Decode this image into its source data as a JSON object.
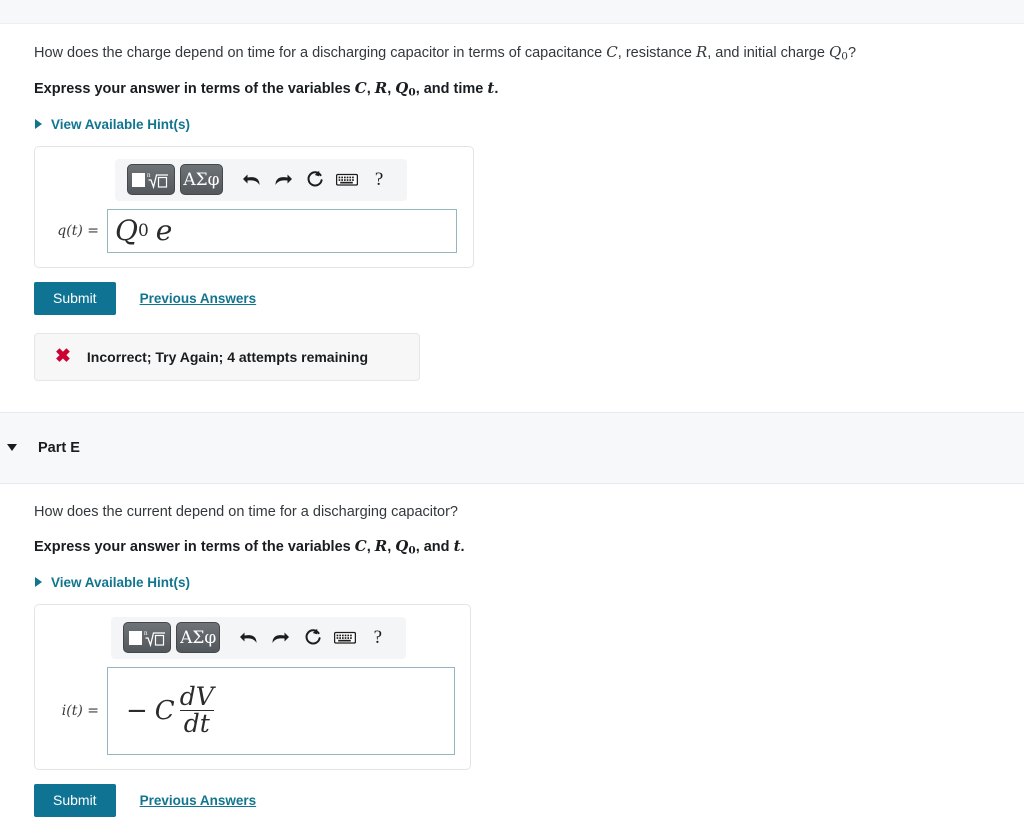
{
  "parts": [
    {
      "id": "part-d",
      "question_prefix": "How does the charge depend on time for a discharging capacitor in terms of capacitance ",
      "question_var1": "C",
      "question_mid1": ", resistance ",
      "question_var2": "R",
      "question_mid2": ", and initial charge ",
      "question_var3": "Q",
      "question_var3_sub": "0",
      "question_suffix": "?",
      "instruction_prefix": "Express your answer in terms of the variables ",
      "instruction_v1": "C",
      "instruction_sep1": ", ",
      "instruction_v2": "R",
      "instruction_sep2": ", ",
      "instruction_v3": "Q",
      "instruction_v3_sub": "0",
      "instruction_mid": ", and time ",
      "instruction_v4": "t",
      "instruction_suffix": ".",
      "hints_label": "View Available Hint(s)",
      "toolbar": {
        "template_button": "template-square-root",
        "greek_button": "ΑΣφ",
        "undo": "undo-arrow",
        "redo": "redo-arrow",
        "reset": "reset-circular-arrow",
        "keyboard": "keyboard",
        "help": "?"
      },
      "answer_label_fn": "q",
      "answer_label_arg": "(t)",
      "answer_label_eq": "=",
      "answer_value": "Q",
      "answer_value_sub": "0",
      "answer_value_tail": "e",
      "submit_label": "Submit",
      "previous_answers_label": "Previous Answers",
      "feedback": {
        "icon": "red-x",
        "text": "Incorrect; Try Again; 4 attempts remaining"
      }
    },
    {
      "id": "part-e",
      "header_title": "Part E",
      "question_text": "How does the current depend on time for a discharging capacitor?",
      "instruction_prefix": "Express your answer in terms of the variables ",
      "instruction_v1": "C",
      "instruction_sep1": ", ",
      "instruction_v2": "R",
      "instruction_sep2": ", ",
      "instruction_v3": "Q",
      "instruction_v3_sub": "0",
      "instruction_mid": ", and ",
      "instruction_v4": "t",
      "instruction_suffix": ".",
      "hints_label": "View Available Hint(s)",
      "toolbar": {
        "template_button": "template-square-root",
        "greek_button": "ΑΣφ",
        "undo": "undo-arrow",
        "redo": "redo-arrow",
        "reset": "reset-circular-arrow",
        "keyboard": "keyboard",
        "help": "?"
      },
      "answer_label_fn": "i",
      "answer_label_arg": "(t)",
      "answer_label_eq": "=",
      "answer_minus": "−",
      "answer_coeff": "C",
      "answer_frac_num": "dV",
      "answer_frac_den": "dt",
      "submit_label": "Submit",
      "previous_answers_label": "Previous Answers"
    }
  ],
  "colors": {
    "accent_link": "#11758f",
    "submit_button": "#0f7494",
    "error_red": "#cc0033",
    "panel_gray": "#f7f8f9",
    "field_border": "#93b6bf"
  }
}
